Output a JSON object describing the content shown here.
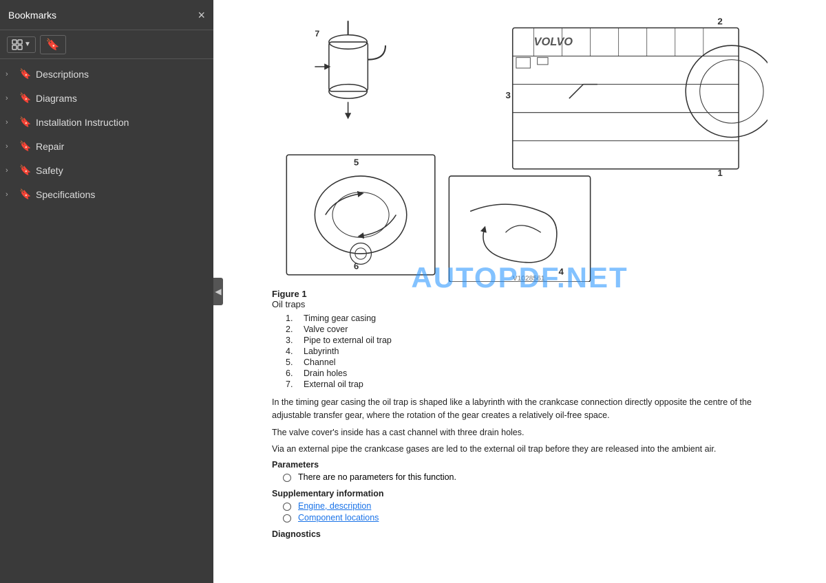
{
  "sidebar": {
    "title": "Bookmarks",
    "items": [
      {
        "id": "descriptions",
        "label": "Descriptions"
      },
      {
        "id": "diagrams",
        "label": "Diagrams"
      },
      {
        "id": "installation-instruction",
        "label": "Installation Instruction"
      },
      {
        "id": "repair",
        "label": "Repair"
      },
      {
        "id": "safety",
        "label": "Safety"
      },
      {
        "id": "specifications",
        "label": "Specifications"
      }
    ],
    "close_label": "×",
    "collapse_label": "◀"
  },
  "watermark": "AUTOPDF.NET",
  "figure": {
    "label": "Figure 1",
    "subtitle": "Oil traps",
    "diagram_ref": "V1028561"
  },
  "numbered_items": [
    {
      "num": "1.",
      "text": "Timing gear casing"
    },
    {
      "num": "2.",
      "text": "Valve cover"
    },
    {
      "num": "3.",
      "text": "Pipe to external oil trap"
    },
    {
      "num": "4.",
      "text": "Labyrinth"
    },
    {
      "num": "5.",
      "text": "Channel"
    },
    {
      "num": "6.",
      "text": "Drain holes"
    },
    {
      "num": "7.",
      "text": "External oil trap"
    }
  ],
  "body_paragraphs": [
    "In the timing gear casing the oil trap is shaped like a labyrinth with the crankcase connection directly opposite the centre of the adjustable transfer gear, where the rotation of the gear creates a relatively oil-free space.",
    "The valve cover's inside has a cast channel with three drain holes.",
    "Via an external pipe the crankcase gases are led to the external oil trap before they are released into the ambient air."
  ],
  "parameters_heading": "Parameters",
  "parameters_item": "There are no parameters for this function.",
  "supplementary_heading": "Supplementary information",
  "supplementary_links": [
    {
      "id": "engine-description",
      "label": "Engine, description"
    },
    {
      "id": "component-locations",
      "label": "Component locations"
    }
  ],
  "diagnostics_heading": "Diagnostics"
}
